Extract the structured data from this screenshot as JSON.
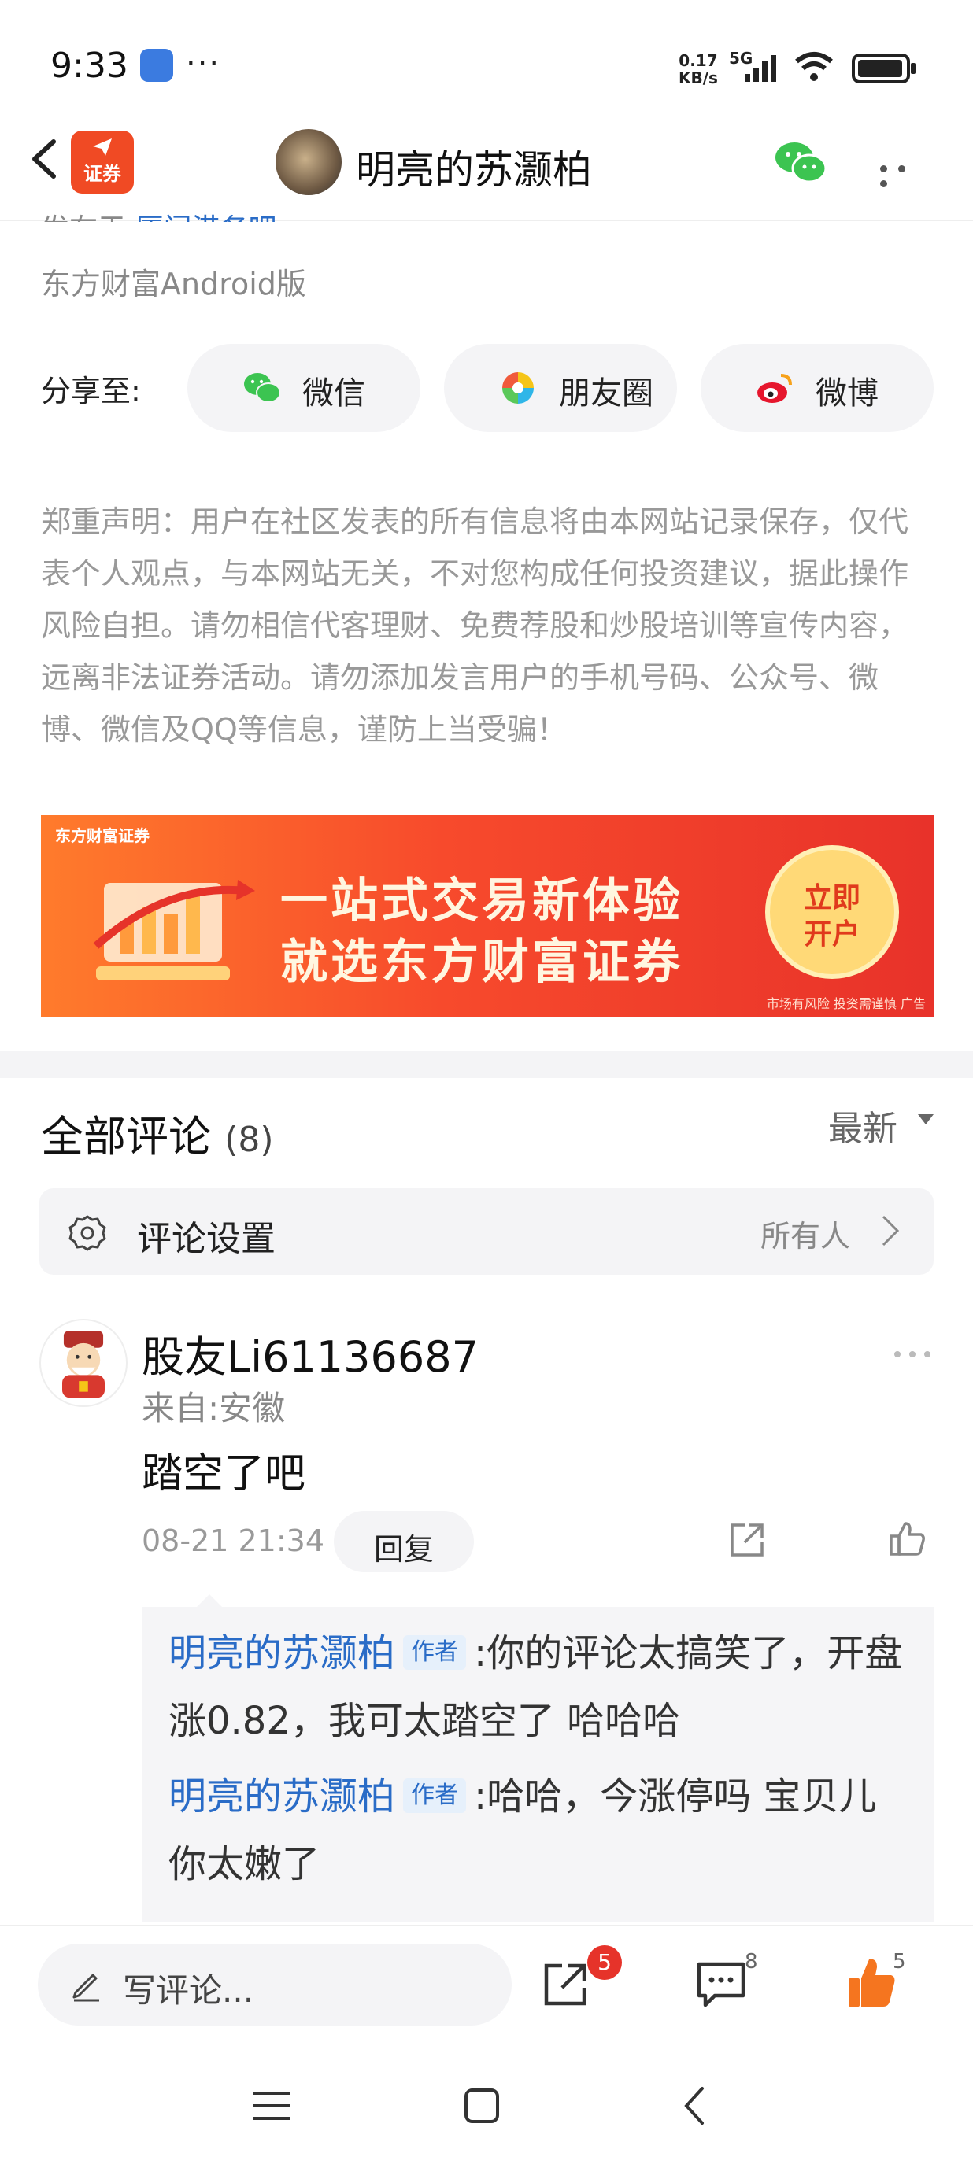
{
  "status_bar": {
    "time": "9:33",
    "dots": "···",
    "net_speed_value": "0.17",
    "net_speed_unit": "KB/s",
    "network": "5G"
  },
  "header": {
    "logo_text": "证券",
    "title": "明亮的苏灏柏"
  },
  "post": {
    "posted_in_prefix": "发布于",
    "posted_in_link": "厦门港务吧",
    "platform": "东方财富Android版"
  },
  "share": {
    "label": "分享至:",
    "options": [
      {
        "label": "微信",
        "icon": "wechat-icon"
      },
      {
        "label": "朋友圈",
        "icon": "moments-icon"
      },
      {
        "label": "微博",
        "icon": "weibo-icon"
      }
    ]
  },
  "disclaimer": "郑重声明：用户在社区发表的所有信息将由本网站记录保存，仅代表个人观点，与本网站无关，不对您构成任何投资建议，据此操作风险自担。请勿相信代客理财、免费荐股和炒股培训等宣传内容，远离非法证券活动。请勿添加发言用户的手机号码、公众号、微博、微信及QQ等信息，谨防上当受骗！",
  "banner": {
    "brand": "东方财富证券",
    "line1": "一站式交易新体验",
    "line2": "就选东方财富证券",
    "cta_line1": "立即",
    "cta_line2": "开户",
    "risk": "市场有风险 投资需谨慎 广告"
  },
  "comments_section": {
    "title": "全部评论",
    "count": "(8)",
    "sort_label": "最新",
    "settings_label": "评论设置",
    "settings_value": "所有人"
  },
  "comments": [
    {
      "user": "股友Li61136687",
      "location": "来自:安徽",
      "text": "踏空了吧",
      "datetime": "08-21 21:34",
      "reply_label": "回复",
      "replies": [
        {
          "name": "明亮的苏灏柏",
          "tag": "作者",
          "text": ":你的评论太搞笑了，开盘涨0.82，我可太踏空了 哈哈哈"
        },
        {
          "name": "明亮的苏灏柏",
          "tag": "作者",
          "text": ":哈哈，今涨停吗 宝贝儿 你太嫩了"
        }
      ]
    }
  ],
  "bottom_bar": {
    "write_placeholder": "写评论...",
    "share_badge": "5",
    "comment_count": "8",
    "like_count": "5"
  },
  "colors": {
    "accent_blue": "#2a6cc7",
    "like_orange": "#f5751f",
    "badge_red": "#e6332a"
  }
}
